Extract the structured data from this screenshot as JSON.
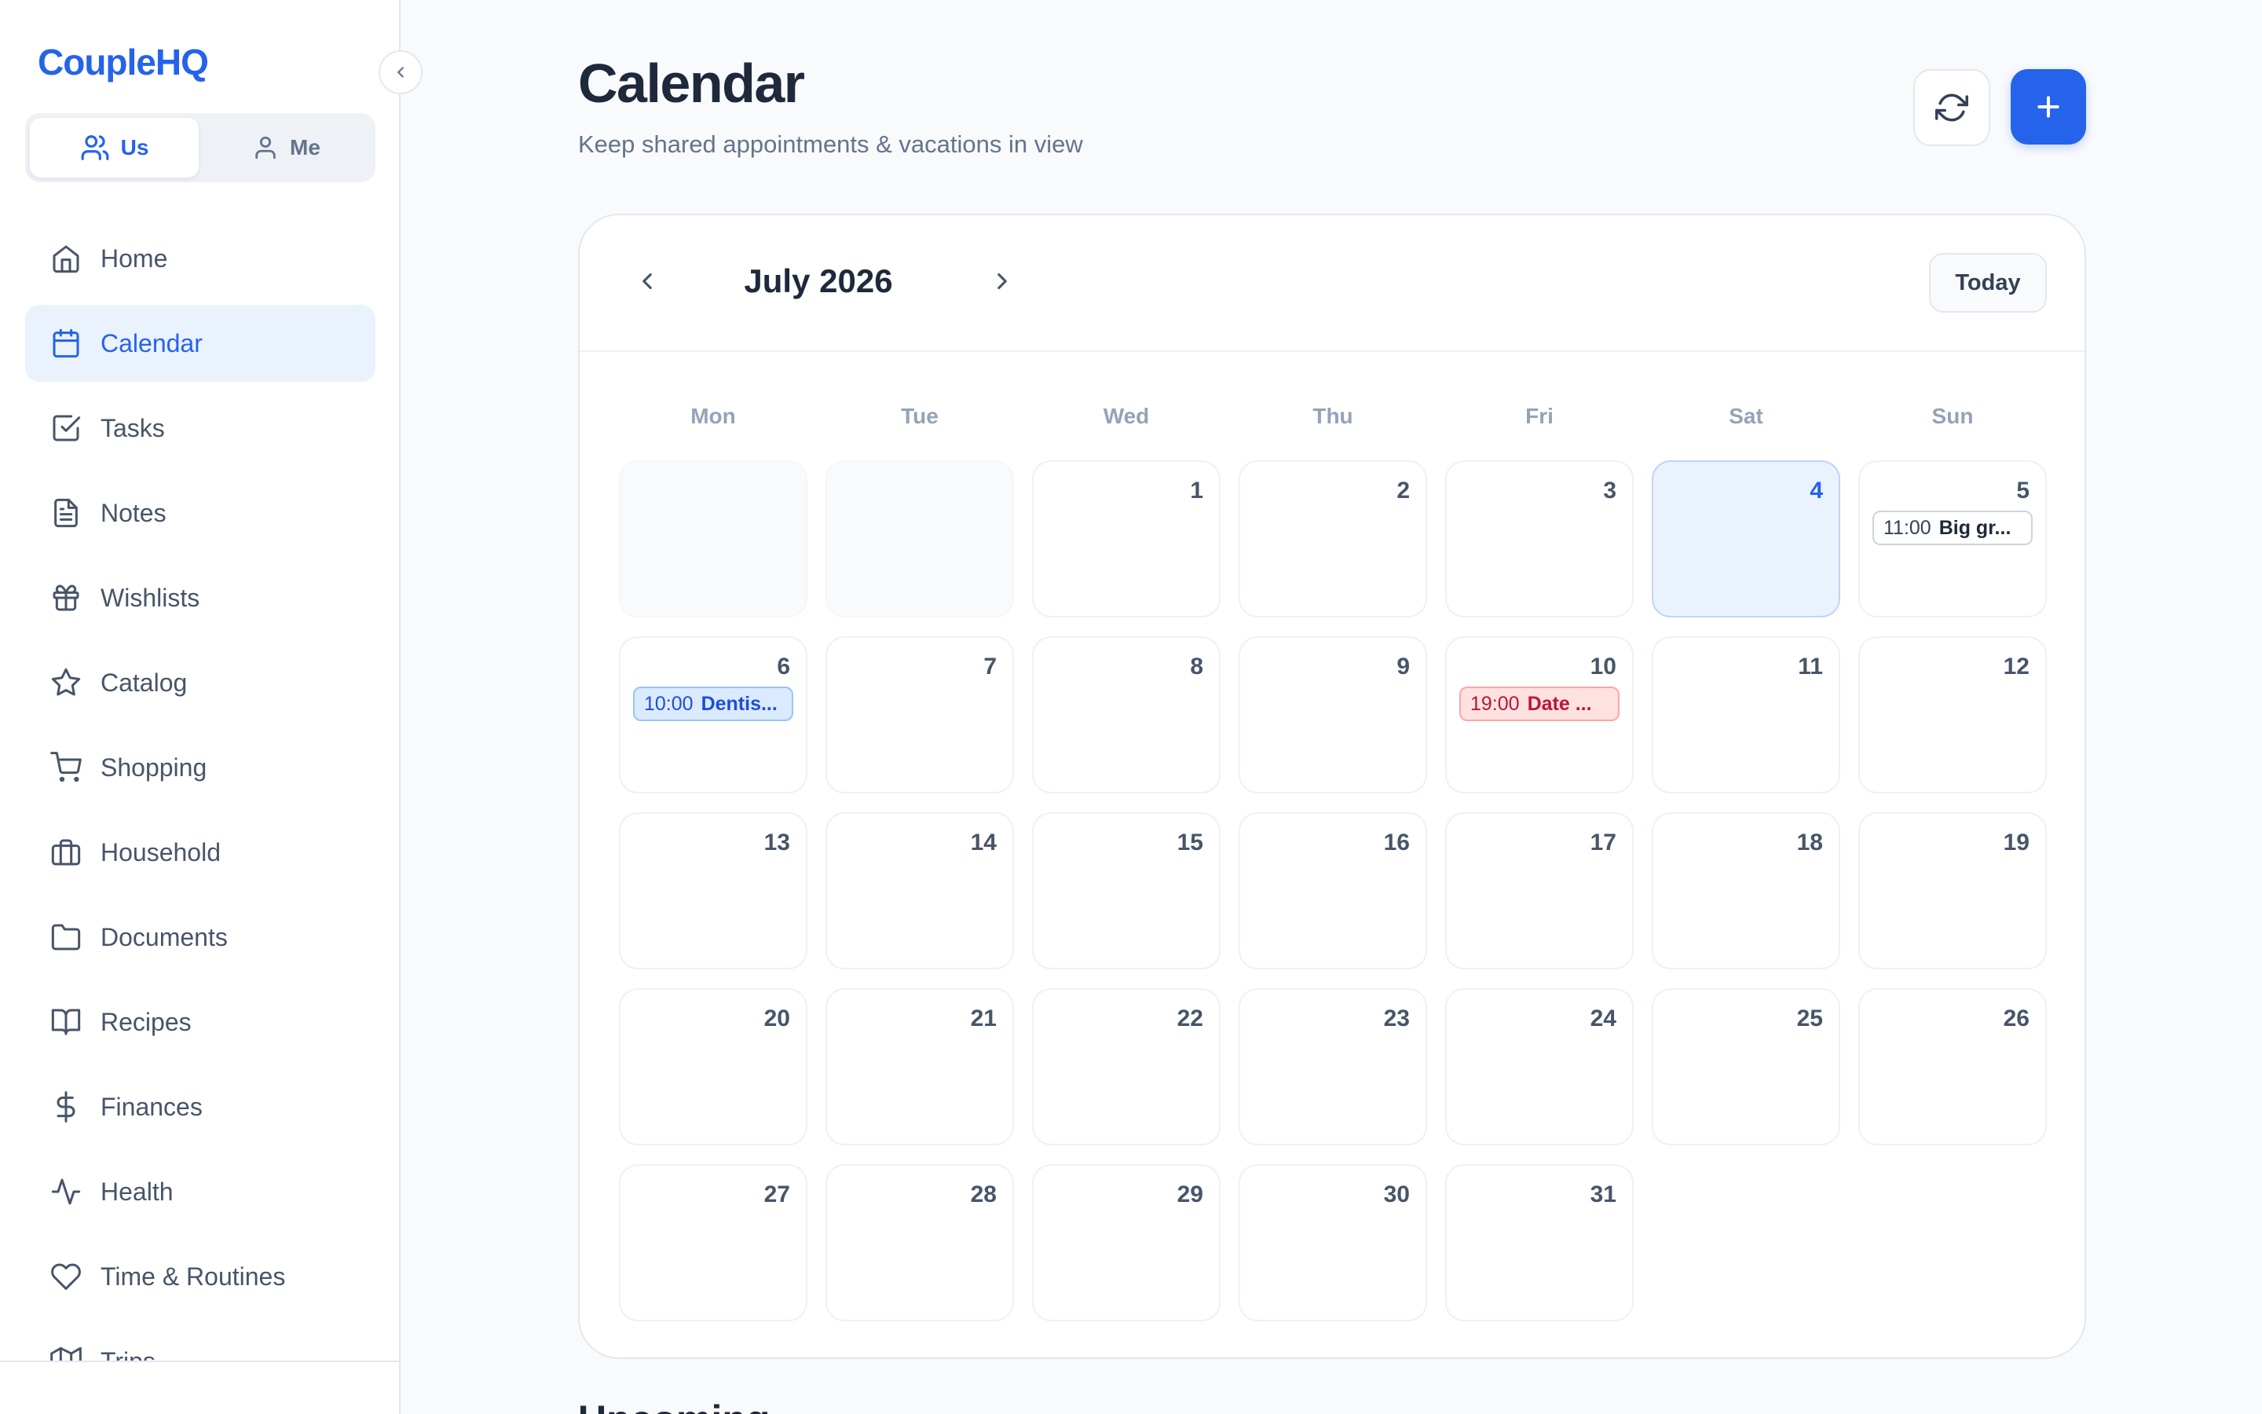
{
  "app": {
    "brand": "CoupleHQ",
    "accent_color": "#2563eb"
  },
  "scope": {
    "options": [
      {
        "label": "Us",
        "icon": "users-icon",
        "active": true
      },
      {
        "label": "Me",
        "icon": "user-icon",
        "active": false
      }
    ]
  },
  "sidebar": {
    "items": [
      {
        "label": "Home",
        "icon": "home-icon"
      },
      {
        "label": "Calendar",
        "icon": "calendar-icon",
        "active": true
      },
      {
        "label": "Tasks",
        "icon": "check-square-icon"
      },
      {
        "label": "Notes",
        "icon": "file-text-icon"
      },
      {
        "label": "Wishlists",
        "icon": "gift-icon"
      },
      {
        "label": "Catalog",
        "icon": "star-icon"
      },
      {
        "label": "Shopping",
        "icon": "shopping-cart-icon"
      },
      {
        "label": "Household",
        "icon": "briefcase-icon"
      },
      {
        "label": "Documents",
        "icon": "folder-icon"
      },
      {
        "label": "Recipes",
        "icon": "book-open-icon"
      },
      {
        "label": "Finances",
        "icon": "dollar-sign-icon"
      },
      {
        "label": "Health",
        "icon": "activity-icon"
      },
      {
        "label": "Time & Routines",
        "icon": "heart-icon"
      },
      {
        "label": "Trips",
        "icon": "map-icon"
      }
    ]
  },
  "header": {
    "title": "Calendar",
    "subtitle": "Keep shared appointments & vacations in view"
  },
  "calendar": {
    "month_label": "July 2026",
    "today_label": "Today",
    "weekdays": [
      "Mon",
      "Tue",
      "Wed",
      "Thu",
      "Fri",
      "Sat",
      "Sun"
    ],
    "leading_empty_days": 2,
    "days_in_month": 31,
    "today": 4,
    "events": [
      {
        "day": 5,
        "time": "11:00",
        "title": "Big gr...",
        "color": "neutral"
      },
      {
        "day": 6,
        "time": "10:00",
        "title": "Dentis...",
        "color": "blue"
      },
      {
        "day": 10,
        "time": "19:00",
        "title": "Date ...",
        "color": "red"
      }
    ]
  },
  "upcoming": {
    "title": "Upcoming"
  }
}
